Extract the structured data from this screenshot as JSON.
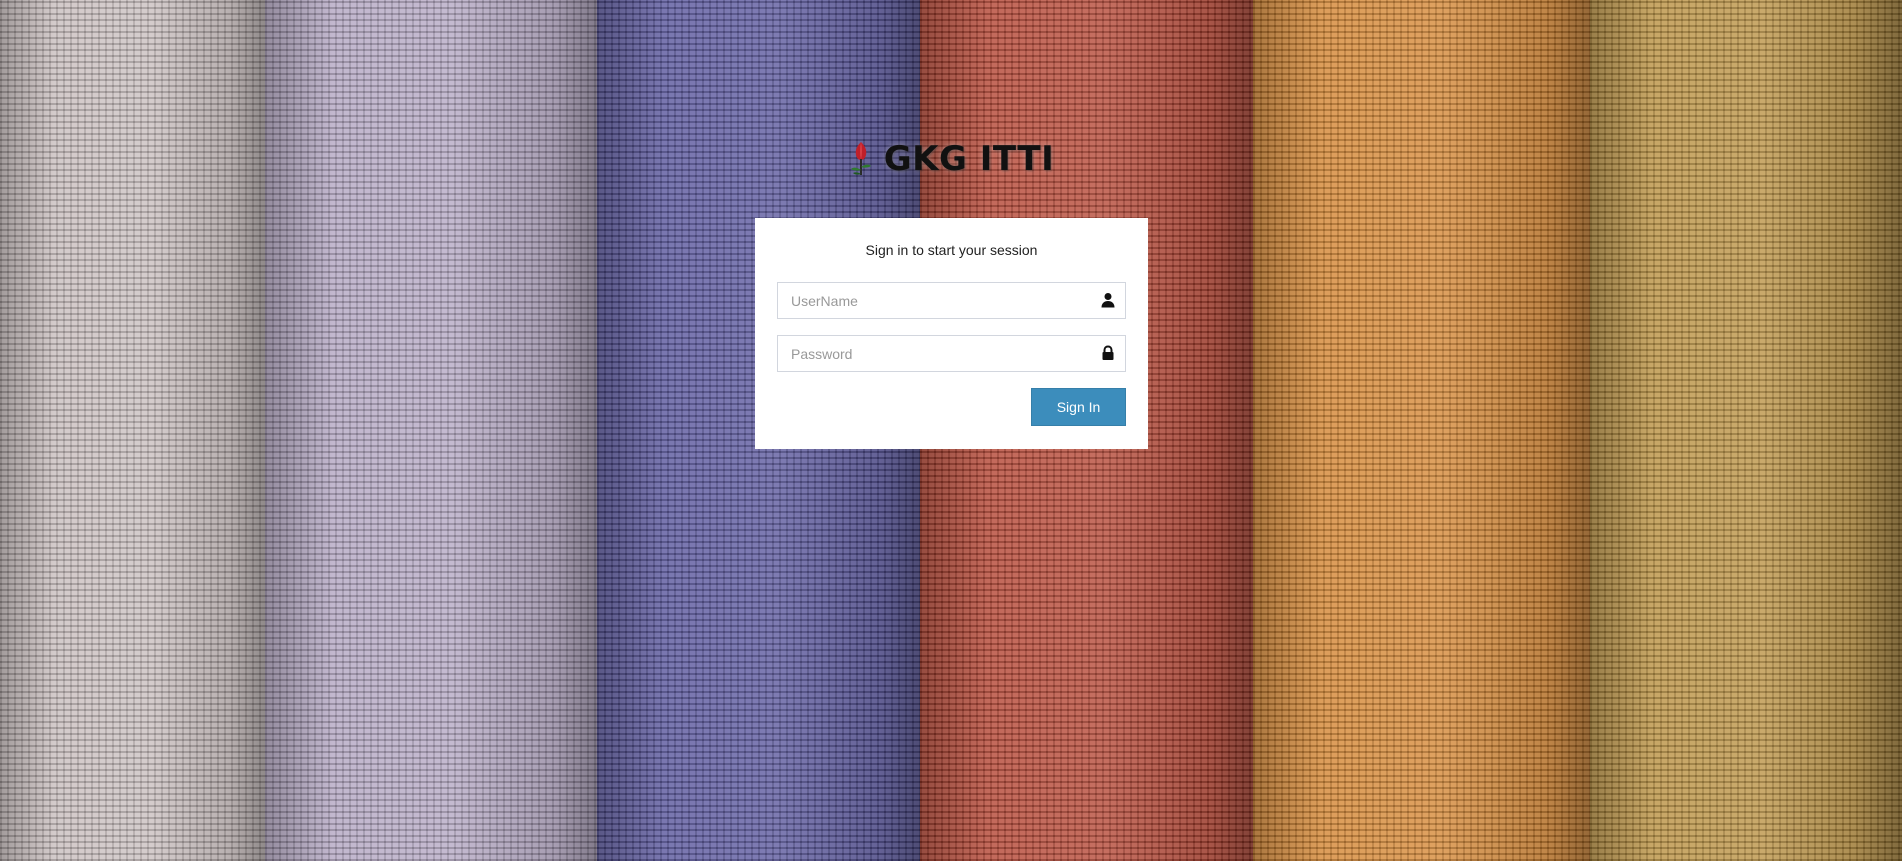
{
  "background": {
    "description_colors": [
      "#c9bfc0",
      "#b0a3c0",
      "#55529a",
      "#b2402f",
      "#d2832f",
      "#b7903f"
    ]
  },
  "brand": {
    "name": "GKG ITTI",
    "logo_icon": "tulip-logo-icon"
  },
  "login": {
    "message": "Sign in to start your session",
    "username": {
      "placeholder": "UserName",
      "value": "",
      "icon": "user-icon"
    },
    "password": {
      "placeholder": "Password",
      "value": "",
      "icon": "lock-icon"
    },
    "submit_label": "Sign In",
    "accent_color": "#3c8dbc"
  }
}
